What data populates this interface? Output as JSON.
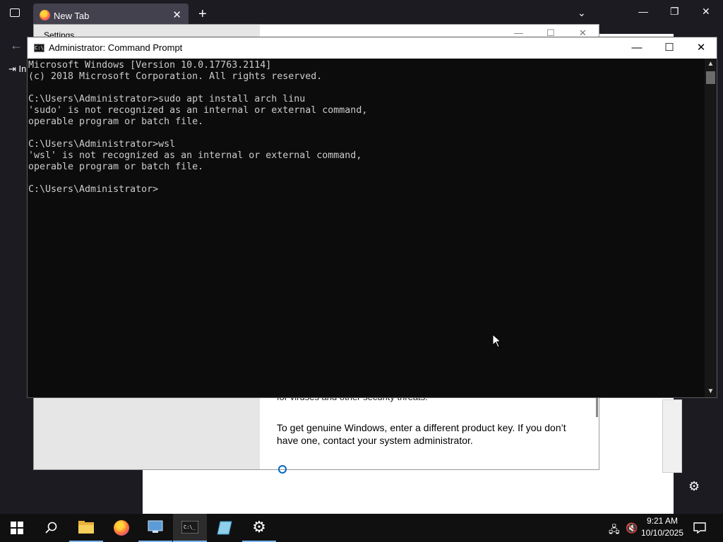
{
  "firefox": {
    "tab_title": "New Tab",
    "tab_close": "✕",
    "new_tab": "+",
    "signin_label": "In",
    "back": "←",
    "list_tabs": "⌄",
    "minimize": "—",
    "restore": "❐",
    "close": "✕"
  },
  "settings": {
    "title": "Settings",
    "partial_text": "for viruses and other security threats.",
    "genuine_text": "To get genuine Windows, enter a different product key. If you don’t have one, contact your system administrator."
  },
  "cmd": {
    "title": "Administrator: Command Prompt",
    "icon_text": "C:\\",
    "minimize": "—",
    "maximize": "☐",
    "close": "✕",
    "lines": [
      "Microsoft Windows [Version 10.0.17763.2114]",
      "(c) 2018 Microsoft Corporation. All rights reserved.",
      "",
      "C:\\Users\\Administrator>sudo apt install arch linu",
      "'sudo' is not recognized as an internal or external command,",
      "operable program or batch file.",
      "",
      "C:\\Users\\Administrator>wsl",
      "'wsl' is not recognized as an internal or external command,",
      "operable program or batch file.",
      "",
      "C:\\Users\\Administrator>"
    ]
  },
  "taskbar": {
    "time": "9:21 AM",
    "date": "10/10/2025",
    "items": [
      "start-button",
      "search-button",
      "file-explorer",
      "firefox",
      "remote-desktop",
      "command-prompt",
      "notepad",
      "settings"
    ]
  }
}
